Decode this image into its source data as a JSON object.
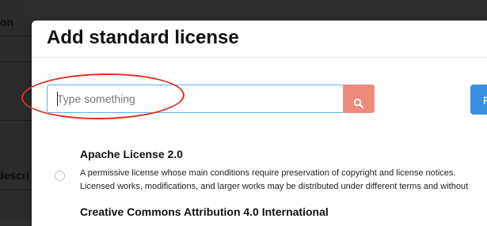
{
  "background": {
    "column_header_text": "on",
    "row_label_text": "descri"
  },
  "modal": {
    "title": "Add standard license"
  },
  "search": {
    "placeholder": "Type something",
    "value": ""
  },
  "right_button": {
    "label": "F"
  },
  "licenses": [
    {
      "name": "Apache License 2.0",
      "description_line1": "A permissive license whose main conditions require preservation of copyright and license notices.",
      "description_line2": "Licensed works, modifications, and larger works may be distributed under different terms and without"
    },
    {
      "name": "Creative Commons Attribution 4.0 International"
    }
  ],
  "colors": {
    "search_button": "#f0897c",
    "input_border": "#66afe9",
    "primary_button": "#3b8fe0",
    "annotation": "#e0301e"
  }
}
